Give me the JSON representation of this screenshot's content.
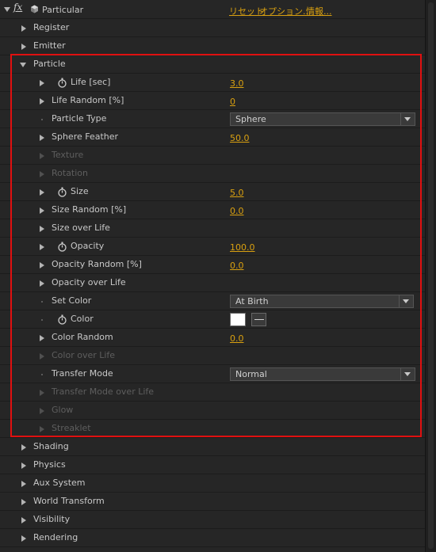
{
  "effect": {
    "fx_label": "fx",
    "name": "Particular",
    "reset_link": "リセット",
    "options_link": "オプション...",
    "about_link": "情報..."
  },
  "groups_top": [
    {
      "label": "Register"
    },
    {
      "label": "Emitter"
    }
  ],
  "particle_group": {
    "label": "Particle",
    "life": {
      "label": "Life [sec]",
      "value": "3.0"
    },
    "life_random": {
      "label": "Life Random [%]",
      "value": "0"
    },
    "particle_type": {
      "label": "Particle Type",
      "selected": "Sphere"
    },
    "sphere_feather": {
      "label": "Sphere Feather",
      "value": "50.0"
    },
    "texture": {
      "label": "Texture"
    },
    "rotation": {
      "label": "Rotation"
    },
    "size": {
      "label": "Size",
      "value": "5.0"
    },
    "size_random": {
      "label": "Size Random [%]",
      "value": "0.0"
    },
    "size_over_life": {
      "label": "Size over Life"
    },
    "opacity": {
      "label": "Opacity",
      "value": "100.0"
    },
    "opacity_random": {
      "label": "Opacity Random [%]",
      "value": "0.0"
    },
    "opacity_over_life": {
      "label": "Opacity over Life"
    },
    "set_color": {
      "label": "Set Color",
      "selected": "At Birth"
    },
    "color": {
      "label": "Color",
      "swatch": "#ffffff"
    },
    "color_random": {
      "label": "Color Random",
      "value": "0.0"
    },
    "color_over_life": {
      "label": "Color over Life"
    },
    "transfer_mode": {
      "label": "Transfer Mode",
      "selected": "Normal"
    },
    "transfer_mode_over_life": {
      "label": "Transfer Mode over Life"
    },
    "glow": {
      "label": "Glow"
    },
    "streaklet": {
      "label": "Streaklet"
    }
  },
  "groups_bottom": [
    {
      "label": "Shading"
    },
    {
      "label": "Physics"
    },
    {
      "label": "Aux System"
    },
    {
      "label": "World Transform"
    },
    {
      "label": "Visibility"
    },
    {
      "label": "Rendering"
    }
  ],
  "colors": {
    "value_accent": "#d9a010",
    "highlight_box": "#e01010",
    "background": "#262626",
    "disabled_text": "#5e5e5e"
  }
}
